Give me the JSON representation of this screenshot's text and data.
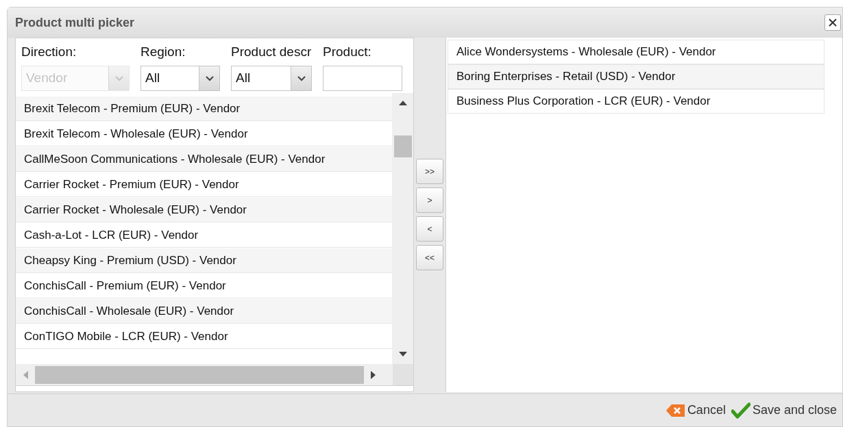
{
  "window": {
    "title": "Product multi picker"
  },
  "filters": [
    {
      "label": "Direction:",
      "kind": "select",
      "value": "Vendor",
      "disabled": true
    },
    {
      "label": "Region:",
      "kind": "select",
      "value": "All",
      "disabled": false
    },
    {
      "label": "Product descr",
      "kind": "select",
      "value": "All",
      "disabled": false
    },
    {
      "label": "Product:",
      "kind": "text"
    }
  ],
  "available": [
    "Brexit Telecom - Premium (EUR) - Vendor",
    "Brexit Telecom - Wholesale (EUR) - Vendor",
    "CallMeSoon Communications - Wholesale (EUR) - Vendor",
    "Carrier Rocket - Premium (EUR) - Vendor",
    "Carrier Rocket - Wholesale (EUR) - Vendor",
    "Cash-a-Lot - LCR (EUR) - Vendor",
    "Cheapsy King - Premium (USD) - Vendor",
    "ConchisCall - Premium (EUR) - Vendor",
    "ConchisCall - Wholesale (EUR) - Vendor",
    "ConTIGO Mobile - LCR (EUR) - Vendor"
  ],
  "move_buttons": [
    ">>",
    ">",
    "<",
    "<<"
  ],
  "selected_items": [
    "Alice Wondersystems - Wholesale (EUR) - Vendor",
    "Boring Enterprises - Retail (USD) - Vendor",
    "Business Plus Corporation - LCR (EUR) - Vendor"
  ],
  "footer": {
    "cancel": "Cancel",
    "save": "Save and close"
  }
}
